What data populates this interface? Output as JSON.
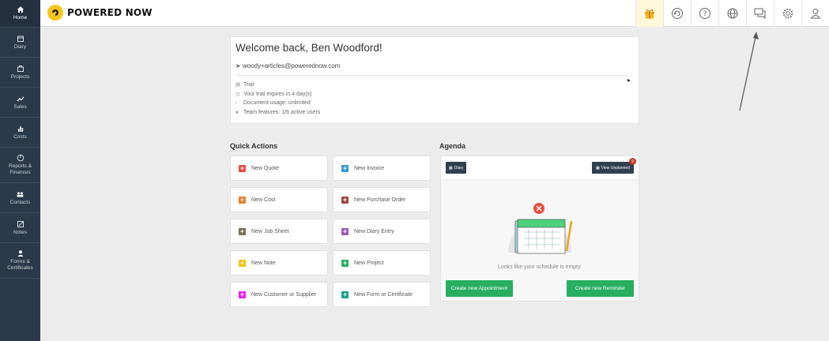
{
  "sidebar": {
    "items": [
      {
        "label": "Home",
        "icon": "home-icon",
        "active": true
      },
      {
        "label": "Diary",
        "icon": "calendar-icon"
      },
      {
        "label": "Projects",
        "icon": "briefcase-icon"
      },
      {
        "label": "Sales",
        "icon": "trend-icon"
      },
      {
        "label": "Costs",
        "icon": "bar-chart-icon"
      },
      {
        "label": "Reports & Finances",
        "icon": "pie-chart-icon"
      },
      {
        "label": "Contacts",
        "icon": "people-icon"
      },
      {
        "label": "Notes",
        "icon": "note-icon"
      },
      {
        "label": "Forms & Certificates",
        "icon": "person-icon"
      }
    ]
  },
  "header": {
    "logo_text": "POWERED NOW",
    "icons": [
      "gift-icon",
      "refresh-icon",
      "help-icon",
      "globe-icon",
      "chat-icon",
      "settings-icon",
      "user-icon"
    ]
  },
  "welcome": {
    "title": "Welcome back, Ben Woodford!",
    "email": "woody+articles@powerednow.com",
    "plan": "Trial",
    "trial_expiry": "Your trial expires in 4 day(s)",
    "document_usage": "Document usage: unlimited",
    "team_features": "Team features: 1/6 active users"
  },
  "quick_actions": {
    "title": "Quick Actions",
    "buttons": [
      {
        "label": "New Quote",
        "color": "#e74c3c"
      },
      {
        "label": "New Invoice",
        "color": "#3498db"
      },
      {
        "label": "New Cost",
        "color": "#e67e22"
      },
      {
        "label": "New Purchase Order",
        "color": "#a0463c"
      },
      {
        "label": "New Job Sheet",
        "color": "#7d6b55"
      },
      {
        "label": "New Diary Entry",
        "color": "#9b59b6"
      },
      {
        "label": "New Note",
        "color": "#f1c40f"
      },
      {
        "label": "New Project",
        "color": "#27ae60"
      },
      {
        "label": "New Customer or Supplier",
        "color": "#e91ef0"
      },
      {
        "label": "New Form or Certificate",
        "color": "#16a085"
      }
    ]
  },
  "agenda": {
    "title": "Agenda",
    "diary_label": "Diary",
    "unplanned_label": "View Unplanned",
    "unplanned_count": "9",
    "empty_text": "Looks like your schedule is empty.",
    "create_appointment": "Create new Appointment",
    "create_reminder": "Create new Reminder"
  }
}
